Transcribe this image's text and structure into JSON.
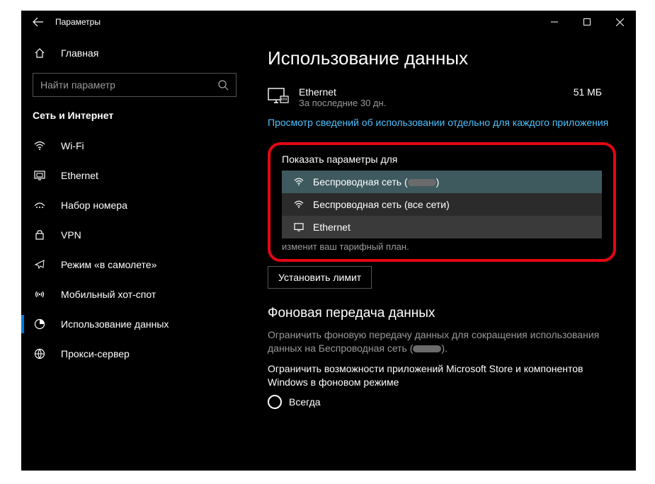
{
  "titlebar": {
    "title": "Параметры"
  },
  "sidebar": {
    "home": "Главная",
    "search_placeholder": "Найти параметр",
    "section": "Сеть и Интернет",
    "items": [
      {
        "label": "Wi-Fi"
      },
      {
        "label": "Ethernet"
      },
      {
        "label": "Набор номера"
      },
      {
        "label": "VPN"
      },
      {
        "label": "Режим «в самолете»"
      },
      {
        "label": "Мобильный хот-спот"
      },
      {
        "label": "Использование данных"
      },
      {
        "label": "Прокси-сервер"
      }
    ]
  },
  "main": {
    "title": "Использование данных",
    "usage": {
      "name": "Ethernet",
      "period": "За последние 30 дн.",
      "value": "51 МБ"
    },
    "link": "Просмотр сведений об использовании отдельно для каждого приложения",
    "dropdown": {
      "label": "Показать параметры для",
      "options": [
        "Беспроводная сеть (",
        "Беспроводная сеть (все сети)",
        "Ethernet"
      ],
      "opt0_suffix": ")"
    },
    "truncated": "изменит ваш тарифный план.",
    "set_limit": "Установить лимит",
    "bg": {
      "heading": "Фоновая передача данных",
      "desc_a": "Ограничить фоновую передачу данных для сокращения использования данных на Беспроводная сеть (",
      "desc_b": ").",
      "desc2": "Ограничить возможности приложений Microsoft Store и компонентов Windows в фоновом режиме",
      "radio1": "Всегда"
    }
  }
}
